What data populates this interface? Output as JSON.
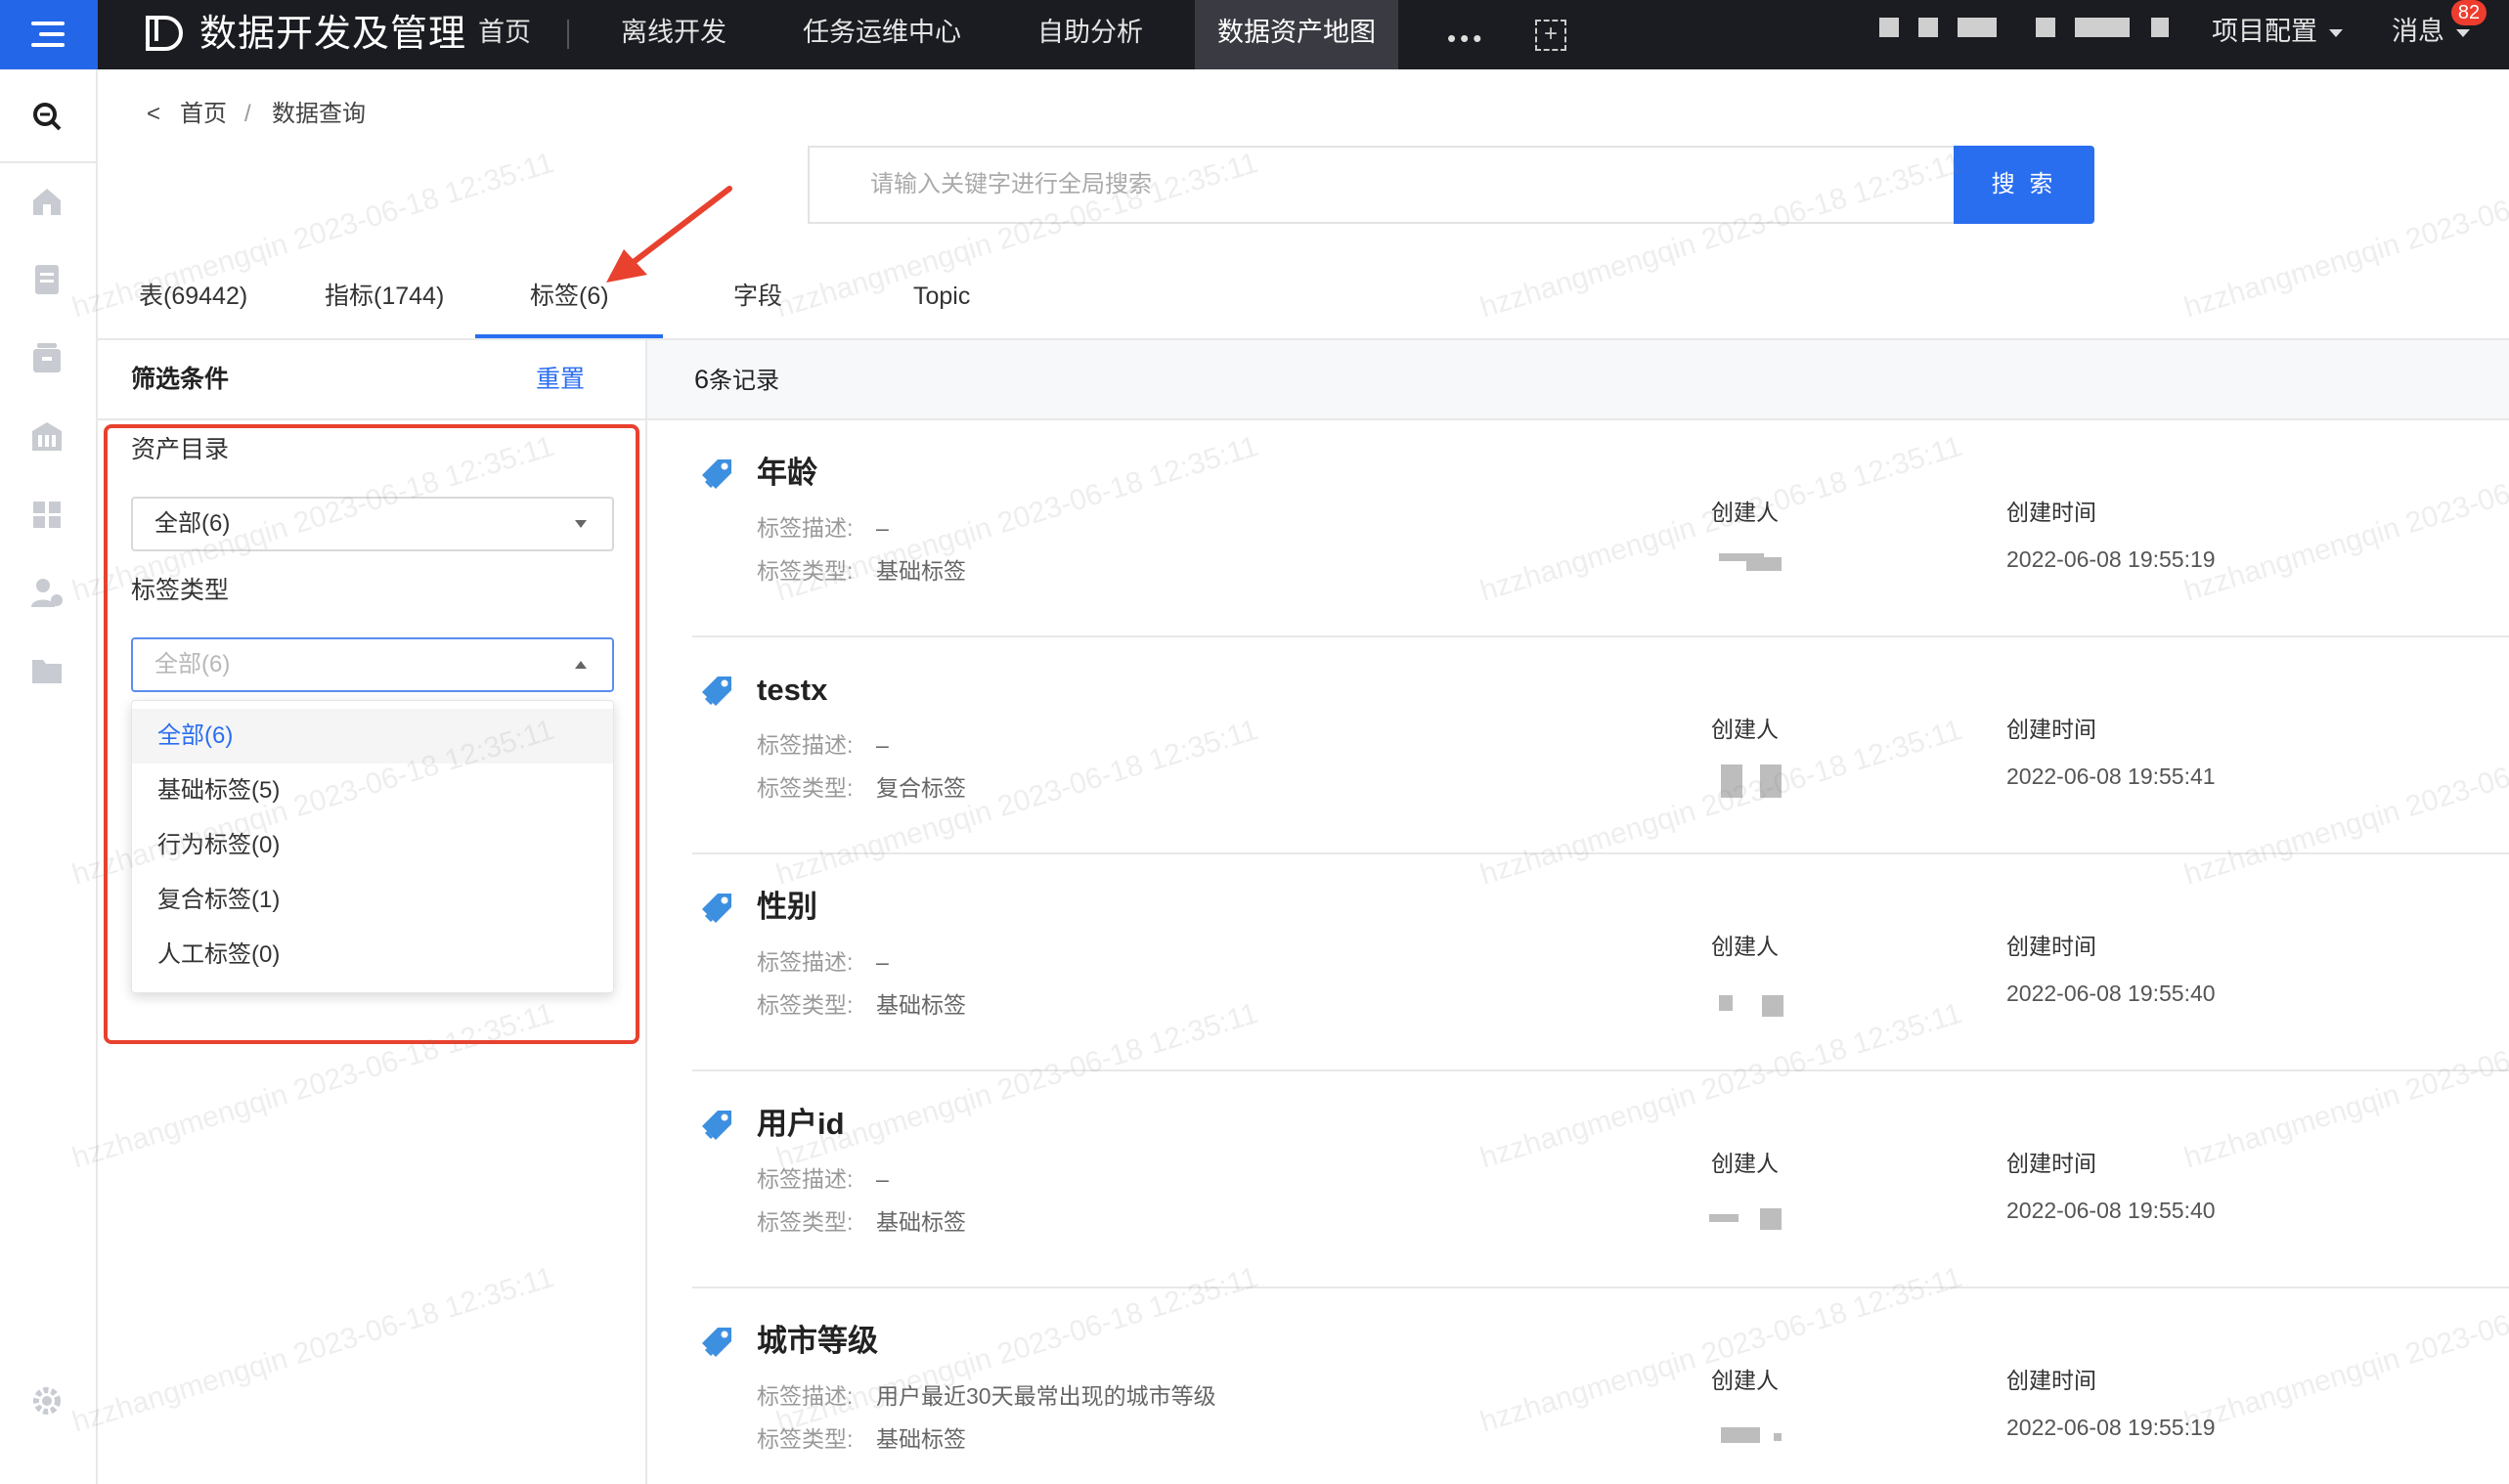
{
  "app": {
    "title": "数据开发及管理",
    "nav": [
      "首页",
      "离线开发",
      "任务运维中心",
      "自助分析",
      "数据资产地图"
    ],
    "more": "•••",
    "project_config": "项目配置",
    "messages": "消息",
    "message_badge": "82"
  },
  "breadcrumb": {
    "back": "<",
    "home": "首页",
    "sep": "/",
    "current": "数据查询"
  },
  "search": {
    "placeholder": "请输入关键字进行全局搜索",
    "button": "搜 索"
  },
  "tabs": [
    "表(69442)",
    "指标(1744)",
    "标签(6)",
    "字段",
    "Topic"
  ],
  "active_tab": "标签(6)",
  "filter": {
    "title": "筛选条件",
    "reset": "重置",
    "catalog_label": "资产目录",
    "catalog_value": "全部(6)",
    "type_label": "标签类型",
    "type_value": "全部(6)",
    "type_options": [
      "全部(6)",
      "基础标签(5)",
      "行为标签(0)",
      "复合标签(1)",
      "人工标签(0)"
    ]
  },
  "results": {
    "count": "6",
    "count_suffix": "条记录",
    "desc_label": "标签描述:",
    "type_label": "标签类型:",
    "creator_label": "创建人",
    "time_label": "创建时间",
    "items": [
      {
        "name": "年龄",
        "desc": "–",
        "type": "基础标签",
        "time": "2022-06-08 19:55:19"
      },
      {
        "name": "testx",
        "desc": "–",
        "type": "复合标签",
        "time": "2022-06-08 19:55:41"
      },
      {
        "name": "性别",
        "desc": "–",
        "type": "基础标签",
        "time": "2022-06-08 19:55:40"
      },
      {
        "name": "用户id",
        "desc": "–",
        "type": "基础标签",
        "time": "2022-06-08 19:55:40"
      },
      {
        "name": "城市等级",
        "desc": "用户最近30天最常出现的城市等级",
        "type": "基础标签",
        "time": "2022-06-08 19:55:19"
      }
    ]
  },
  "watermark": "hzzhangmengqin 2023-06-18 12:35:11",
  "colors": {
    "primary": "#2a6ef0",
    "topbar": "#1b1c21",
    "annotation": "#e8412e",
    "tag_icon": "#3d8fe0"
  }
}
